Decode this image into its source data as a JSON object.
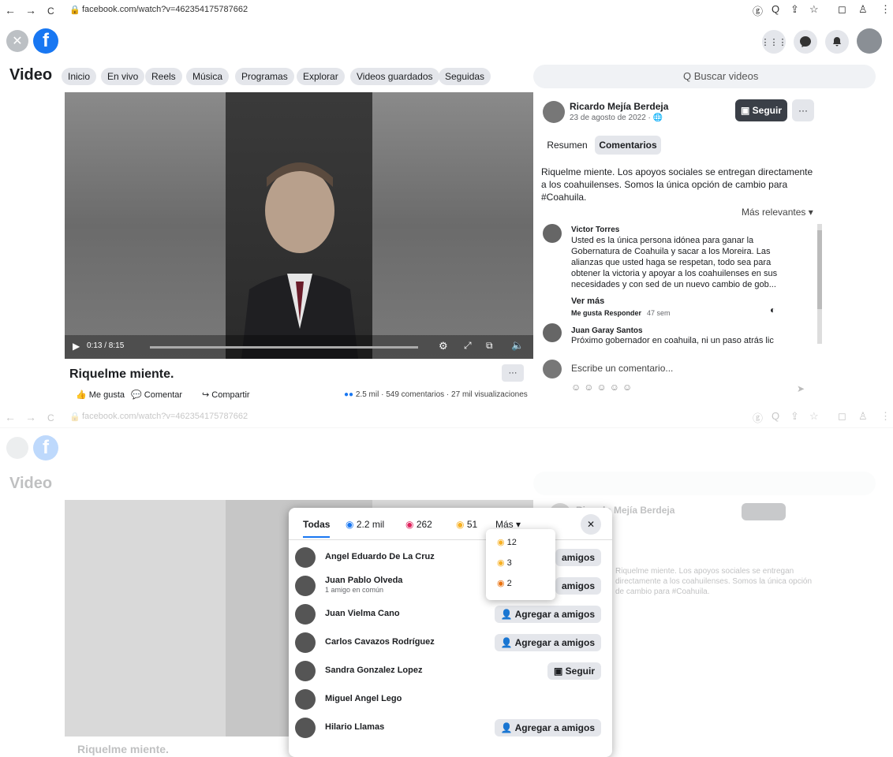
{
  "browser": {
    "url": "facebook.com/watch?v=462354175787662",
    "back_icon": "←",
    "forward_icon": "→",
    "reload_icon": "C",
    "icons": [
      "ⓖ",
      "Q",
      "⇪",
      "☆",
      "◻",
      "♙",
      "⋮"
    ]
  },
  "header": {
    "menu_glyph": "⋮⋮⋮"
  },
  "videobar": {
    "title": "Video",
    "pills": [
      "Inicio",
      "En vivo",
      "Reels",
      "Música",
      "Programas",
      "Explorar",
      "Videos guardados",
      "Seguidas"
    ],
    "search_placeholder": "Q Buscar videos"
  },
  "player": {
    "time": "0:13 / 8:15"
  },
  "caption": {
    "title": "Riquelme miente.",
    "more": "···",
    "like": "Me gusta",
    "comment": "Comentar",
    "share": "Compartir",
    "reactions": "2.5 mil",
    "comments": "549 comentarios",
    "views": "27 mil visualizaciones"
  },
  "post": {
    "author": "Ricardo Mejía Berdeja",
    "date": "23 de agosto de 2022 · ",
    "follow": "Seguir",
    "more": "···",
    "tab_summary": "Resumen",
    "tab_comments": "Comentarios",
    "text": "Riquelme miente. Los apoyos sociales se entregan directamente a los coahuilenses. Somos la única opción de cambio para #Coahuila.",
    "sort": "Más relevantes ▾"
  },
  "comments": [
    {
      "author": "Victor Torres",
      "text": "Usted es la única persona idónea para ganar la Gobernatura de Coahuila y sacar a los Moreira. Las alianzas que usted haga se respetan, todo sea para obtener la victoria y apoyar a los coahuilenses en sus necesidades y con sed de un nuevo cambio de gob...",
      "see_more": "Ver más",
      "like": "Me gusta",
      "reply": "Responder",
      "time": "47 sem"
    },
    {
      "author": "Juan Garay Santos",
      "text": "Próximo gobernador en coahuila, ni un paso atrás lic"
    }
  ],
  "write_comment": "Escribe un comentario...",
  "modal": {
    "tab_all": "Todas",
    "tab_like_count": "2.2 mil",
    "tab_love_count": "262",
    "tab_care_count": "51",
    "tab_more": "Más ▾",
    "close": "✕",
    "dropdown": [
      "12",
      "3",
      "2"
    ],
    "people": [
      {
        "name": "Angel Eduardo De La Cruz",
        "sub": "",
        "button": "amigos"
      },
      {
        "name": "Juan Pablo Olveda",
        "sub": "1 amigo en común",
        "button": "amigos"
      },
      {
        "name": "Juan Vielma Cano",
        "sub": "",
        "button": "Agregar a amigos"
      },
      {
        "name": "Carlos Cavazos Rodríguez",
        "sub": "",
        "button": "Agregar a amigos"
      },
      {
        "name": "Sandra Gonzalez Lopez",
        "sub": "",
        "button": "Seguir"
      },
      {
        "name": "Miguel Angel Lego",
        "sub": "",
        "button": ""
      },
      {
        "name": "Hilario Llamas",
        "sub": "",
        "button": "Agregar a amigos"
      }
    ]
  },
  "colors": {
    "brand": "#1877f2",
    "follow_bg": "#3a3f47",
    "pill": "#e4e6eb"
  }
}
